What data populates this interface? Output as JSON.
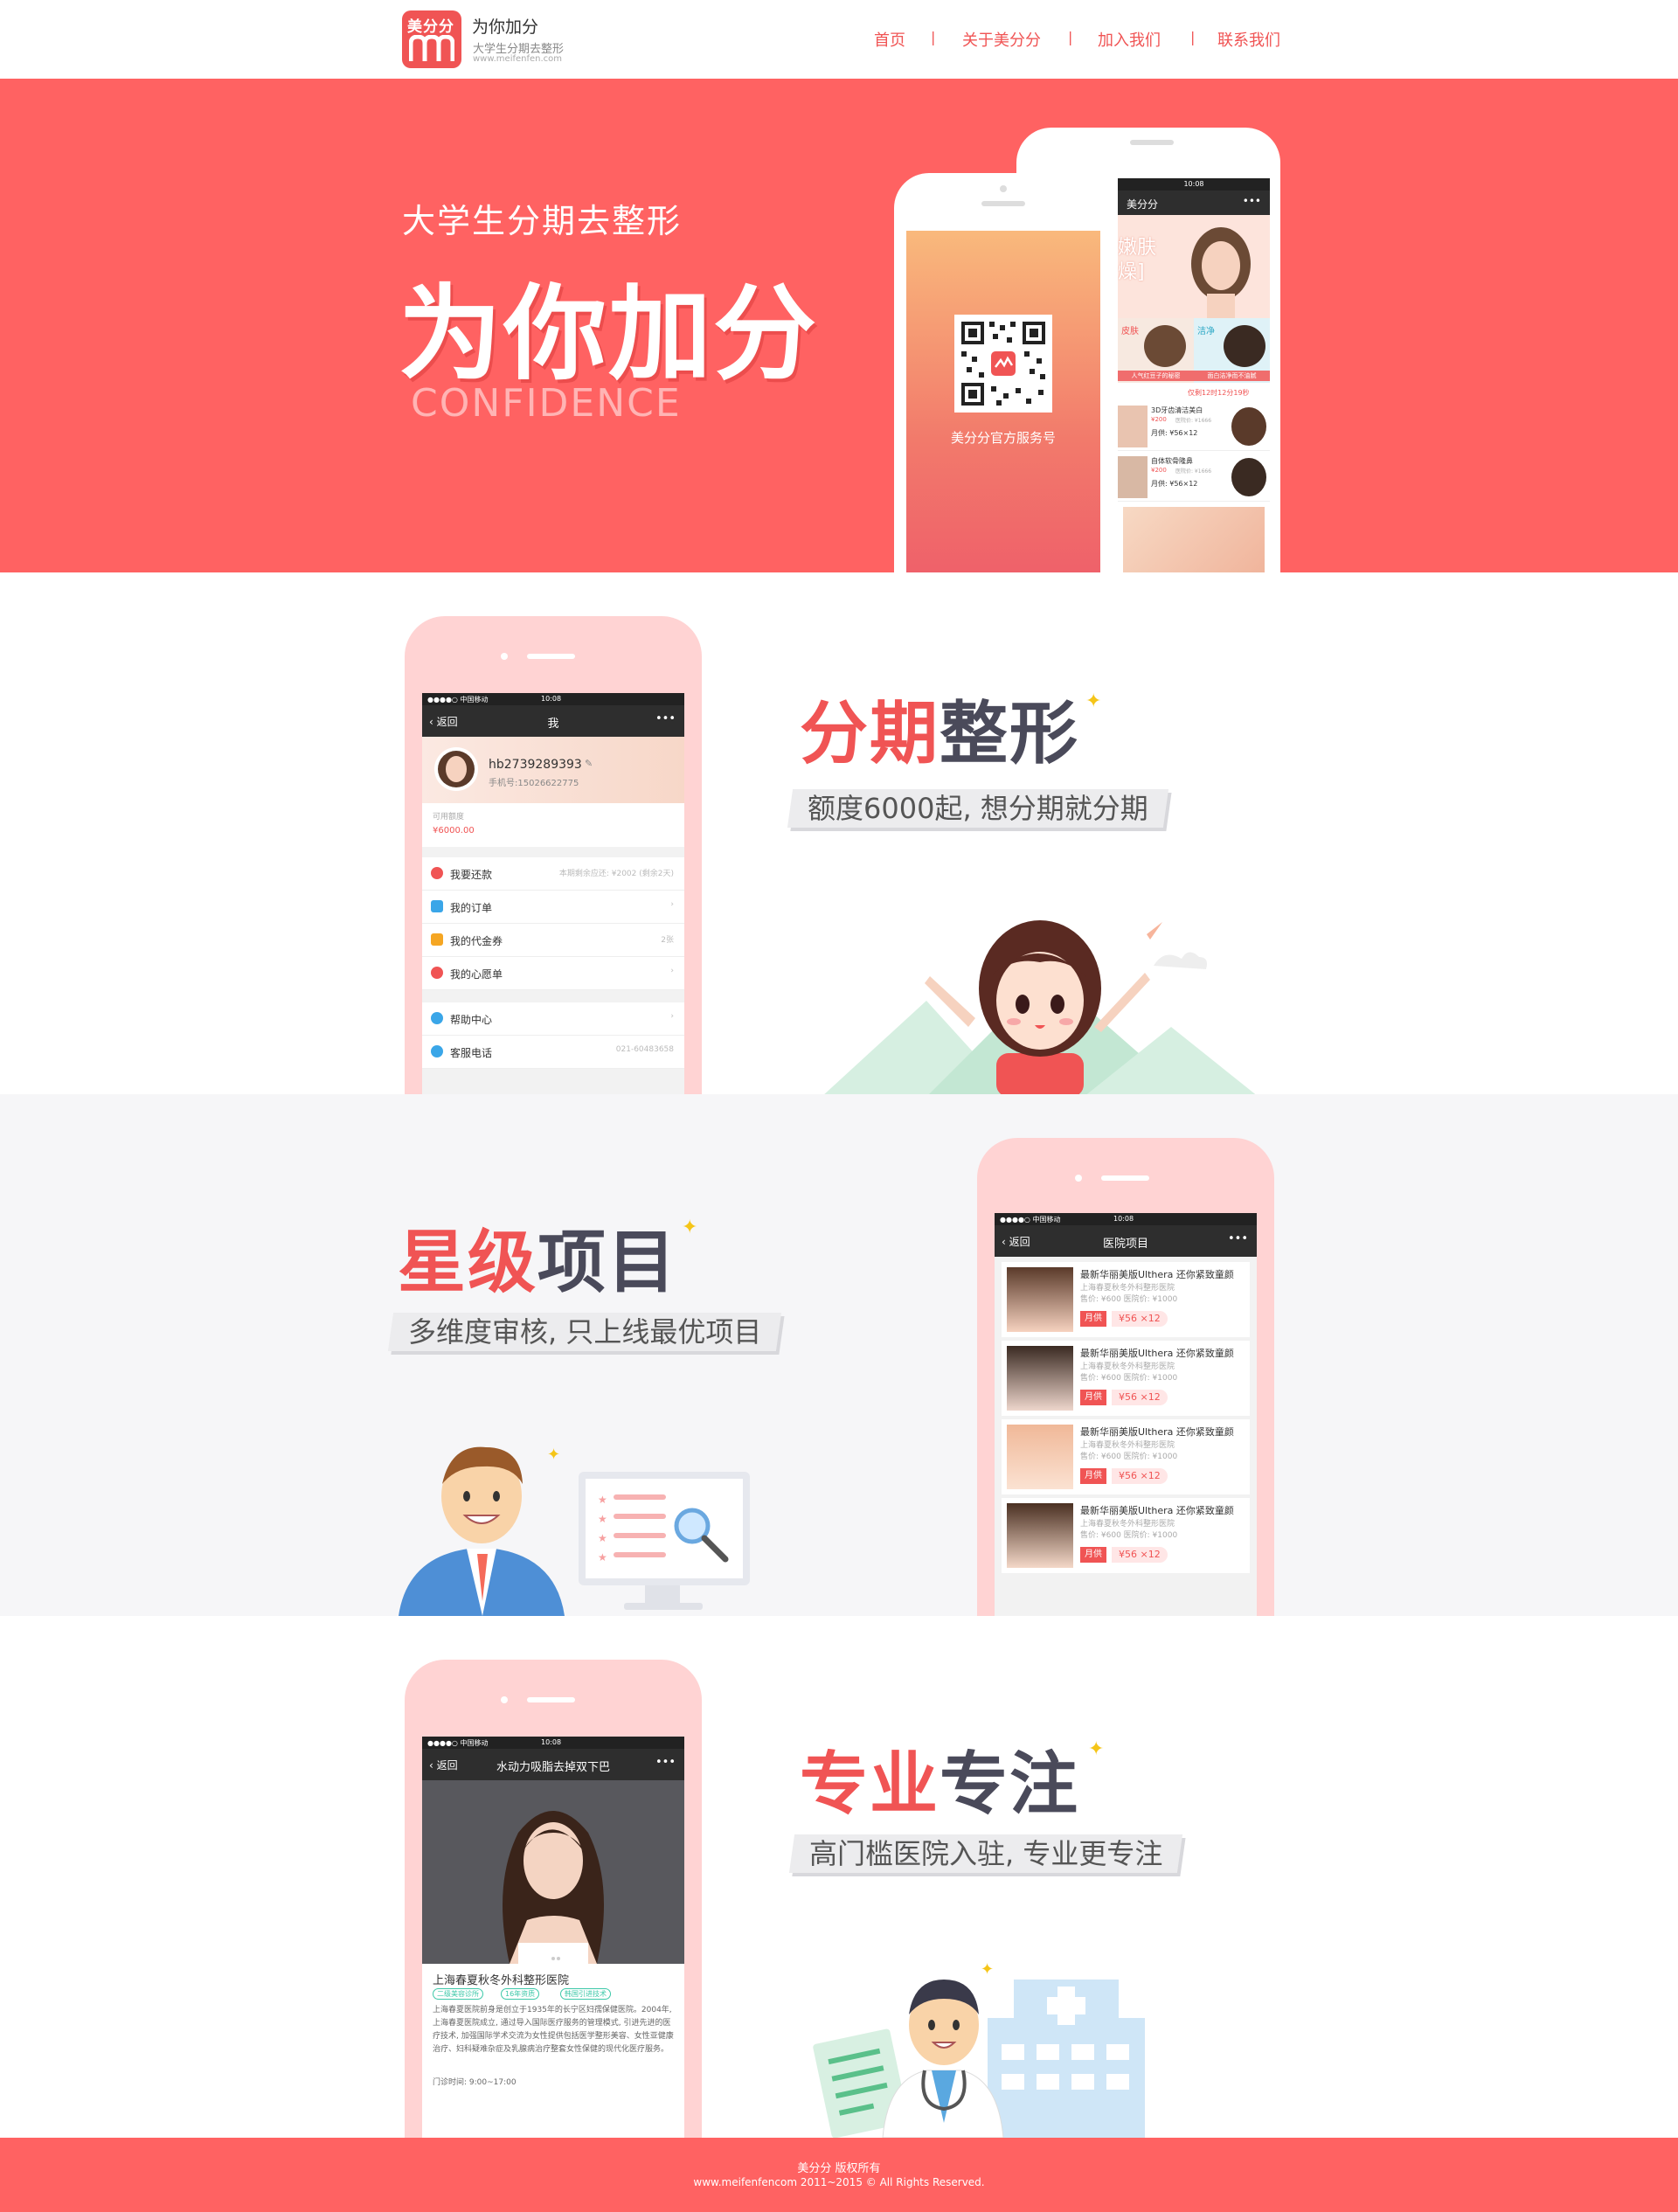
{
  "header": {
    "logo_text": "美分分",
    "brand_name": "为你加分",
    "brand_tagline": "大学生分期去整形",
    "brand_url": "www.meifenfen.com",
    "nav": [
      "首页",
      "关于美分分",
      "加入我们",
      "联系我们"
    ],
    "nav_separator": "|"
  },
  "hero": {
    "subtitle": "大学生分期去整形",
    "title": "为你加分",
    "english": "CONFIDENCE",
    "qr_caption": "美分分官方服务号",
    "back_phone": {
      "time": "10:08",
      "title": "美分分",
      "banner_text": "嫩肤\n燥]",
      "tiles": [
        "皮肤",
        "洁净"
      ],
      "tile_captions": [
        "人气红豆子的秘密",
        "面白洁净而不油腻"
      ],
      "countdown": "仅剩12时12分19秒",
      "items": [
        {
          "name": "3D牙齿清洁美白",
          "price": "¥200",
          "orig": "医院价: ¥1666",
          "monthly": "月供: ¥56×12"
        },
        {
          "name": "自体软骨隆鼻",
          "price": "¥200",
          "orig": "医院价: ¥1666",
          "monthly": "月供: ¥56×12"
        }
      ]
    }
  },
  "feature1": {
    "title_a": "分期",
    "title_b": "整形",
    "desc": "额度6000起, 想分期就分期",
    "phone": {
      "carrier": "●●●●○ 中国移动",
      "time": "10:08",
      "back": "返回",
      "title": "我",
      "more": "•••",
      "username": "hb2739289393",
      "phone_label": "手机号:15026622775",
      "credit_label": "可用额度",
      "credit_value": "¥6000.00",
      "menu": [
        {
          "label": "我要还款",
          "right": "本期剩余应还: ¥2002 (剩余2天)",
          "color": "#f05454"
        },
        {
          "label": "我的订单",
          "right": "",
          "color": "#3aa6e8"
        },
        {
          "label": "我的代金券",
          "right": "2张",
          "color": "#f5a623"
        },
        {
          "label": "我的心愿单",
          "right": "",
          "color": "#f05454"
        },
        {
          "label": "帮助中心",
          "right": "",
          "color": "#3aa6e8"
        },
        {
          "label": "客服电话",
          "right": "021-60483658",
          "color": "#3aa6e8"
        }
      ]
    }
  },
  "feature2": {
    "title_a": "星级",
    "title_b": "项目",
    "desc": "多维度审核, 只上线最优项目",
    "phone": {
      "carrier": "●●●●○ 中国移动",
      "time": "10:08",
      "back": "返回",
      "title": "医院项目",
      "more": "•••",
      "items": [
        {
          "name": "最新华丽美版Ulthera 还你紧致童颜",
          "hospital": "上海春夏秋冬外科整形医院",
          "price": "售价: ¥600  医院价: ¥1000",
          "pay": "月供",
          "amount": "¥56 ×12"
        },
        {
          "name": "最新华丽美版Ulthera 还你紧致童颜",
          "hospital": "上海春夏秋冬外科整形医院",
          "price": "售价: ¥600  医院价: ¥1000",
          "pay": "月供",
          "amount": "¥56 ×12"
        },
        {
          "name": "最新华丽美版Ulthera 还你紧致童颜",
          "hospital": "上海春夏秋冬外科整形医院",
          "price": "售价: ¥600  医院价: ¥1000",
          "pay": "月供",
          "amount": "¥56 ×12"
        },
        {
          "name": "最新华丽美版Ulthera 还你紧致童颜",
          "hospital": "上海春夏秋冬外科整形医院",
          "price": "售价: ¥600  医院价: ¥1000",
          "pay": "月供",
          "amount": "¥56 ×12"
        }
      ]
    }
  },
  "feature3": {
    "title_a": "专业",
    "title_b": "专注",
    "desc": "高门槛医院入驻, 专业更专注",
    "phone": {
      "carrier": "●●●●○ 中国移动",
      "time": "10:08",
      "back": "返回",
      "title": "水动力吸脂去掉双下巴",
      "more": "•••",
      "hospital": "上海春夏秋冬外科整形医院",
      "tags": [
        "二级美容诊所",
        "16年资质",
        "韩国引进技术"
      ],
      "intro": "上海春夏医院前身是创立于1935年的长宁区妇孺保健医院。2004年, 上海春夏医院成立, 通过导入国际医疗服务的管理模式, 引进先进的医疗技术, 加强国际学术交流为女性提供包括医学整形美容、女性亚健康治疗、妇科疑难杂症及乳腺病治疗整套女性保健的现代化医疗服务。",
      "hours": "门诊时间: 9:00~17:00"
    }
  },
  "footer": {
    "line1": "美分分 版权所有",
    "line2": "www.meifenfencom 2011~2015 © All Rights Reserved."
  },
  "colors": {
    "brand": "#ff6262",
    "accent": "#f05454",
    "dark": "#4a4a5a"
  }
}
